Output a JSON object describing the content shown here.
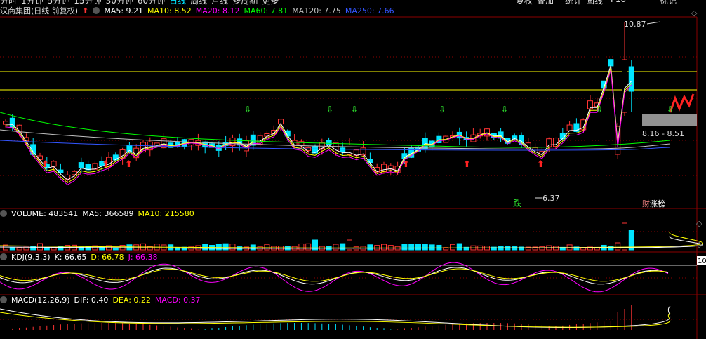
{
  "top_bar": {
    "tabs": [
      "分时",
      "1分钟",
      "5分钟",
      "15分钟",
      "30分钟",
      "60分钟",
      "日线",
      "周线",
      "月线",
      "多周期",
      "更多"
    ],
    "active_tab": "日线",
    "right_buttons": [
      "复权",
      "叠加",
      "统计",
      "画线",
      "F10",
      "标记"
    ]
  },
  "price_panel": {
    "title": "汉商集团(日线 前复权)",
    "ma": [
      {
        "label": "MA5: 9.21",
        "color": "#ffffff"
      },
      {
        "label": "MA10: 8.52",
        "color": "#ffff00"
      },
      {
        "label": "MA20: 8.12",
        "color": "#ff00ff"
      },
      {
        "label": "MA60: 7.81",
        "color": "#00ff00"
      },
      {
        "label": "MA120: 7.75",
        "color": "#c0c0c0"
      },
      {
        "label": "MA250: 7.66",
        "color": "#3355ff"
      }
    ],
    "high_label": "10.87",
    "low_label": "6.37",
    "range_label": "8.16 - 8.51",
    "tag_down": "跌",
    "tag_up": "涨榜",
    "tag_fin": "财"
  },
  "volume_panel": {
    "items": [
      {
        "label": "VOLUME: 483541",
        "color": "#ffffff"
      },
      {
        "label": "MA5: 366589",
        "color": "#ffffff"
      },
      {
        "label": "MA10: 215580",
        "color": "#ffff00"
      }
    ]
  },
  "kdj_panel": {
    "items": [
      {
        "label": "KDJ(9,3,3)",
        "color": "#ffffff"
      },
      {
        "label": "K: 66.65",
        "color": "#ffffff"
      },
      {
        "label": "D: 66.78",
        "color": "#ffff00"
      },
      {
        "label": "J: 66.38",
        "color": "#ff00ff"
      }
    ],
    "right_tag": "10"
  },
  "macd_panel": {
    "items": [
      {
        "label": "MACD(12,26,9)",
        "color": "#ffffff"
      },
      {
        "label": "DIF: 0.40",
        "color": "#ffffff"
      },
      {
        "label": "DEA: 0.22",
        "color": "#ffff00"
      },
      {
        "label": "MACD: 0.37",
        "color": "#ff00ff"
      }
    ]
  },
  "colors": {
    "up": "#ff3333",
    "down": "#00e5ff",
    "grid": "#8b0000"
  }
}
